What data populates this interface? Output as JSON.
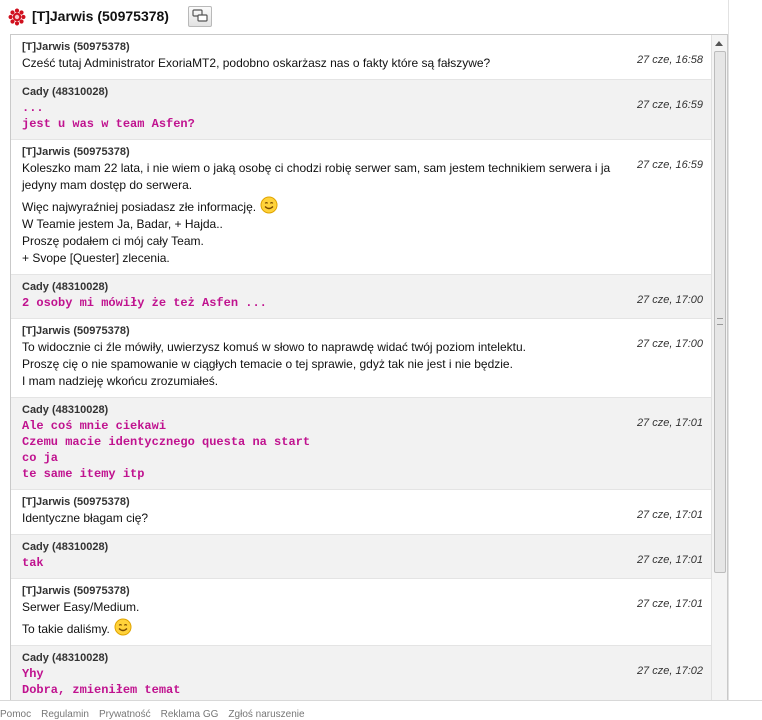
{
  "window": {
    "title": "[T]Jarwis (50975378)",
    "status_icon": "gadu-status-flower-icon",
    "action_icon": "chat-bubbles-icon"
  },
  "colors": {
    "status_red": "#d0101e",
    "mono_text": "#c0128f",
    "row_alt": "#f2f2f2"
  },
  "messages": [
    {
      "author": "[T]Jarwis (50975378)",
      "time": "27 cze, 16:58",
      "mono": false,
      "lines": [
        "Cześć tutaj Administrator ExoriaMT2, podobno oskarżasz nas o fakty które są fałszywe?"
      ]
    },
    {
      "author": "Cady (48310028)",
      "time": "27 cze, 16:59",
      "mono": true,
      "lines": [
        "...",
        "jest u was w team Asfen?"
      ]
    },
    {
      "author": "[T]Jarwis (50975378)",
      "time": "27 cze, 16:59",
      "mono": false,
      "lines": [
        "Koleszko mam 22 lata, i nie wiem o jaką osobę ci chodzi robię serwer sam, sam jestem technikiem serwera i ja jedyny mam dostęp do serwera.",
        "Więc najwyraźniej posiadasz złe informację.",
        "W Teamie jestem Ja, Badar, + Hajda..",
        "Proszę podałem ci mój cały Team.",
        "+ Svope [Quester] zlecenia."
      ],
      "emoticon_line": 1
    },
    {
      "author": "Cady (48310028)",
      "time": "27 cze, 17:00",
      "mono": true,
      "lines": [
        "2 osoby mi mówiły że też Asfen ..."
      ]
    },
    {
      "author": "[T]Jarwis (50975378)",
      "time": "27 cze, 17:00",
      "mono": false,
      "lines": [
        "To widocznie ci źle mówiły, uwierzysz komuś w słowo to naprawdę widać twój poziom intelektu.",
        "Proszę cię o nie spamowanie w ciągłych temacie o tej sprawie, gdyż tak nie jest i nie będzie.",
        "I mam nadzieję wkońcu zrozumiałeś."
      ]
    },
    {
      "author": "Cady (48310028)",
      "time": "27 cze, 17:01",
      "mono": true,
      "lines": [
        "Ale coś mnie ciekawi",
        "Czemu macie identycznego questa na start",
        "co ja",
        "te same itemy itp"
      ]
    },
    {
      "author": "[T]Jarwis (50975378)",
      "time": "27 cze, 17:01",
      "mono": false,
      "lines": [
        "Identyczne błagam cię?"
      ]
    },
    {
      "author": "Cady (48310028)",
      "time": "27 cze, 17:01",
      "mono": true,
      "lines": [
        "tak"
      ]
    },
    {
      "author": "[T]Jarwis (50975378)",
      "time": "27 cze, 17:01",
      "mono": false,
      "lines": [
        "Serwer Easy/Medium.",
        "To takie daliśmy."
      ],
      "emoticon_line": 1
    },
    {
      "author": "Cady (48310028)",
      "time": "27 cze, 17:02",
      "mono": true,
      "lines": [
        "Yhy",
        "Dobra, zmieniłem temat"
      ]
    }
  ],
  "footer": {
    "links": [
      "Pomoc",
      "Regulamin",
      "Prywatność",
      "Reklama GG",
      "Zgłoś naruszenie"
    ]
  }
}
